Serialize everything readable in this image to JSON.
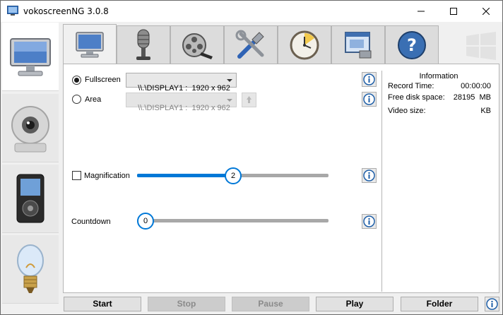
{
  "window": {
    "title": "vokoscreenNG 3.0.8"
  },
  "sidebar": {
    "items": [
      {
        "name": "monitor-icon"
      },
      {
        "name": "webcam-icon"
      },
      {
        "name": "media-player-icon"
      },
      {
        "name": "lightbulb-icon"
      }
    ]
  },
  "tabs": [
    {
      "name": "tab-screen",
      "icon": "monitor-icon"
    },
    {
      "name": "tab-audio",
      "icon": "microphone-icon"
    },
    {
      "name": "tab-video",
      "icon": "film-reel-icon"
    },
    {
      "name": "tab-settings",
      "icon": "tools-icon"
    },
    {
      "name": "tab-timer",
      "icon": "clock-icon"
    },
    {
      "name": "tab-log",
      "icon": "window-icon"
    },
    {
      "name": "tab-help",
      "icon": "help-icon"
    }
  ],
  "screen": {
    "fullscreen_label": "Fullscreen",
    "fullscreen_value": "\\\\.\\DISPLAY1 :  1920 x 962",
    "area_label": "Area",
    "area_value": "\\\\.\\DISPLAY1 :  1920 x 962",
    "magnification_label": "Magnification",
    "magnification_value": "2",
    "magnification_level": 0.5,
    "countdown_label": "Countdown",
    "countdown_value": "0",
    "countdown_level": 0
  },
  "information": {
    "title": "Information",
    "record_time_label": "Record Time:",
    "record_time_value": "00:00:00",
    "free_disk_label": "Free disk space:",
    "free_disk_value": "28195",
    "free_disk_unit": "MB",
    "video_size_label": "Video size:",
    "video_size_unit": "KB"
  },
  "buttons": {
    "start": "Start",
    "stop": "Stop",
    "pause": "Pause",
    "play": "Play",
    "folder": "Folder"
  },
  "colors": {
    "accent": "#0078d7"
  }
}
